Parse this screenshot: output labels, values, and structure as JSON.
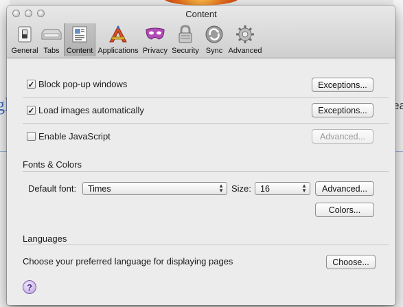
{
  "window": {
    "title": "Content"
  },
  "tabs": [
    {
      "label": "General",
      "icon": "general-switch-icon"
    },
    {
      "label": "Tabs",
      "icon": "tabs-icon"
    },
    {
      "label": "Content",
      "icon": "content-page-icon",
      "active": true
    },
    {
      "label": "Applications",
      "icon": "applications-icon"
    },
    {
      "label": "Privacy",
      "icon": "privacy-mask-icon"
    },
    {
      "label": "Security",
      "icon": "security-lock-icon"
    },
    {
      "label": "Sync",
      "icon": "sync-icon"
    },
    {
      "label": "Advanced",
      "icon": "advanced-gear-icon"
    }
  ],
  "content": {
    "block_popups": {
      "label": "Block pop-up windows",
      "checked": true,
      "button": "Exceptions..."
    },
    "load_images": {
      "label": "Load images automatically",
      "checked": true,
      "button": "Exceptions..."
    },
    "javascript": {
      "label": "Enable JavaScript",
      "checked": false,
      "button": "Advanced..."
    }
  },
  "fonts": {
    "heading": "Fonts & Colors",
    "default_font_label": "Default font:",
    "default_font_value": "Times",
    "size_label": "Size:",
    "size_value": "16",
    "advanced_button": "Advanced...",
    "colors_button": "Colors..."
  },
  "languages": {
    "heading": "Languages",
    "description": "Choose your preferred language for displaying pages",
    "choose_button": "Choose..."
  },
  "help": {
    "symbol": "?"
  },
  "background": {
    "left_fragment": "gl",
    "right_fragment": "ea"
  },
  "colors": {
    "help_purple": "#b89be0",
    "background_link_blue": "#3d6ec4"
  }
}
